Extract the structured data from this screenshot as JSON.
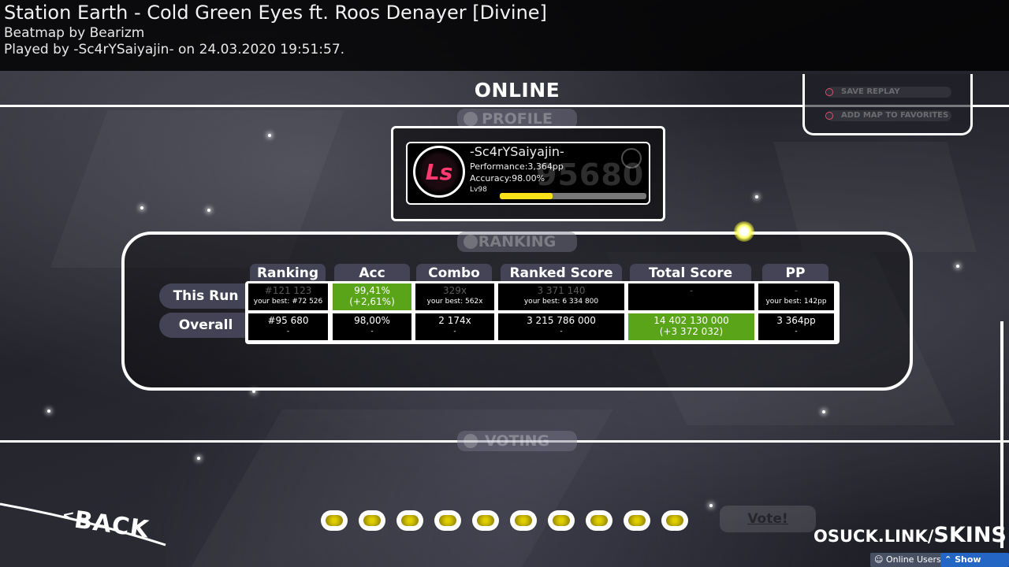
{
  "header": {
    "title": "Station Earth - Cold Green Eyes ft. Roos Denayer [Divine]",
    "beatmap_by": "Beatmap by Bearizm",
    "played_by": "Played by -Sc4rYSaiyajin- on 24.03.2020 19:51:57."
  },
  "online": {
    "title": "ONLINE"
  },
  "options": {
    "save_replay": "SAVE REPLAY",
    "add_favorites": "ADD MAP TO FAVORITES"
  },
  "tabs": {
    "profile": "PROFILE",
    "ranking": "RANKING",
    "voting": "VOTING"
  },
  "profile": {
    "username": "-Sc4rYSaiyajin-",
    "performance": "Performance:3,364pp",
    "accuracy": "Accuracy:98.00%",
    "level": "Lv98",
    "level_progress": 0.36,
    "rank_bg": "95680",
    "avatar_text": "Ls"
  },
  "ranking": {
    "columns": [
      "Ranking",
      "Acc",
      "Combo",
      "Ranked Score",
      "Total Score",
      "PP"
    ],
    "rows": [
      "This Run",
      "Overall"
    ],
    "this_run": {
      "ranking": {
        "v": "#121 123",
        "s": "your best: #72 526"
      },
      "acc": {
        "v": "99,41%",
        "s": "(+2,61%)"
      },
      "combo": {
        "v": "329x",
        "s": "your best: 562x"
      },
      "ranked_score": {
        "v": "3 371 140",
        "s": "your best: 6 334 800"
      },
      "total_score": {
        "v": "-",
        "s": ""
      },
      "pp": {
        "v": "-",
        "s": "your best: 142pp"
      }
    },
    "overall": {
      "ranking": {
        "v": "#95 680",
        "s": "-"
      },
      "acc": {
        "v": "98,00%",
        "s": "-"
      },
      "combo": {
        "v": "2 174x",
        "s": "-"
      },
      "ranked_score": {
        "v": "3 215 786 000",
        "s": "-"
      },
      "total_score": {
        "v": "14 402 130 000",
        "s": "(+3 372 032)"
      },
      "pp": {
        "v": "3 364pp",
        "s": "-"
      }
    }
  },
  "voting": {
    "vote_label": "Vote!",
    "star_count": 10
  },
  "back_label": "BACK",
  "watermark": {
    "a": "OSUCK.LINK/",
    "b": "SKINS"
  },
  "bottom": {
    "online_users": "Online Users",
    "show_chat": "Show Chat"
  },
  "colors": {
    "green": "#5aa41a",
    "level_bar": "#ffe01a",
    "accent_pink": "#ff3a70"
  }
}
